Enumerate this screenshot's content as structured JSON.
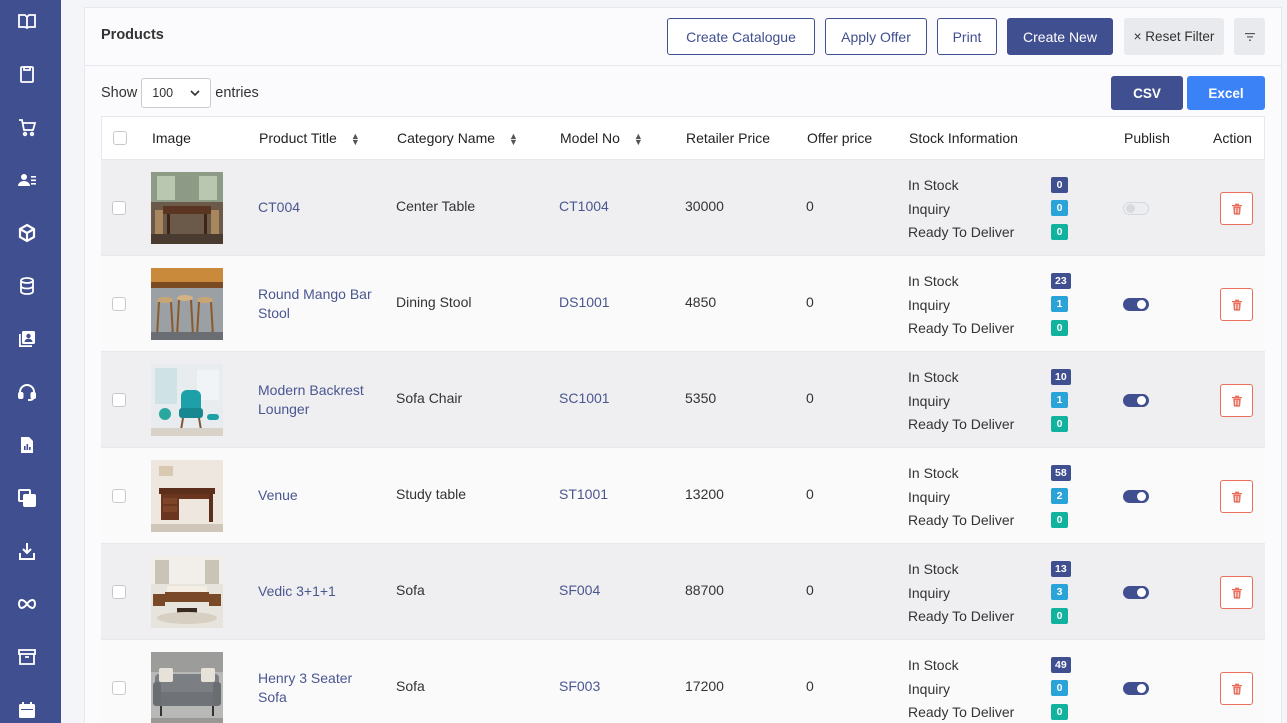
{
  "sidebar": {
    "icons": [
      "book-open-icon",
      "clipboard-icon",
      "cart-icon",
      "users-list-icon",
      "box-icon",
      "database-icon",
      "contacts-icon",
      "headset-icon",
      "report-icon",
      "copy-icon",
      "download-icon",
      "infinity-icon",
      "archive-icon",
      "calendar-icon"
    ]
  },
  "header": {
    "title": "Products",
    "buttons": {
      "create_catalogue": "Create Catalogue",
      "apply_offer": "Apply Offer",
      "print": "Print",
      "create_new": "Create New",
      "reset_filter": "× Reset Filter"
    }
  },
  "toolbar": {
    "show_label": "Show",
    "entries_value": "100",
    "entries_label": "entries",
    "csv": "CSV",
    "excel": "Excel"
  },
  "table": {
    "columns": {
      "image": "Image",
      "title": "Product Title",
      "category": "Category Name",
      "model": "Model No",
      "retail": "Retailer Price",
      "offer": "Offer price",
      "stock": "Stock Information",
      "publish": "Publish",
      "action": "Action"
    },
    "stock_labels": {
      "in_stock": "In Stock",
      "inquiry": "Inquiry",
      "ready": "Ready To Deliver"
    },
    "rows": [
      {
        "title": "CT004",
        "category": "Center Table",
        "model": "CT1004",
        "retail": "30000",
        "offer": "0",
        "in_stock": "0",
        "inquiry": "0",
        "ready": "0",
        "published": false
      },
      {
        "title": "Round Mango Bar Stool",
        "category": "Dining Stool",
        "model": "DS1001",
        "retail": "4850",
        "offer": "0",
        "in_stock": "23",
        "inquiry": "1",
        "ready": "0",
        "published": true
      },
      {
        "title": "Modern Backrest Lounger",
        "category": "Sofa Chair",
        "model": "SC1001",
        "retail": "5350",
        "offer": "0",
        "in_stock": "10",
        "inquiry": "1",
        "ready": "0",
        "published": true
      },
      {
        "title": "Venue",
        "category": "Study table",
        "model": "ST1001",
        "retail": "13200",
        "offer": "0",
        "in_stock": "58",
        "inquiry": "2",
        "ready": "0",
        "published": true
      },
      {
        "title": "Vedic 3+1+1",
        "category": "Sofa",
        "model": "SF004",
        "retail": "88700",
        "offer": "0",
        "in_stock": "13",
        "inquiry": "3",
        "ready": "0",
        "published": true
      },
      {
        "title": "Henry 3 Seater Sofa",
        "category": "Sofa",
        "model": "SF003",
        "retail": "17200",
        "offer": "0",
        "in_stock": "49",
        "inquiry": "0",
        "ready": "0",
        "published": true
      }
    ]
  },
  "colors": {
    "primary": "#404f8f",
    "excel": "#3b82f6",
    "badge_blue": "#29a3d8",
    "badge_teal": "#12b39e",
    "delete": "#e8705d"
  }
}
